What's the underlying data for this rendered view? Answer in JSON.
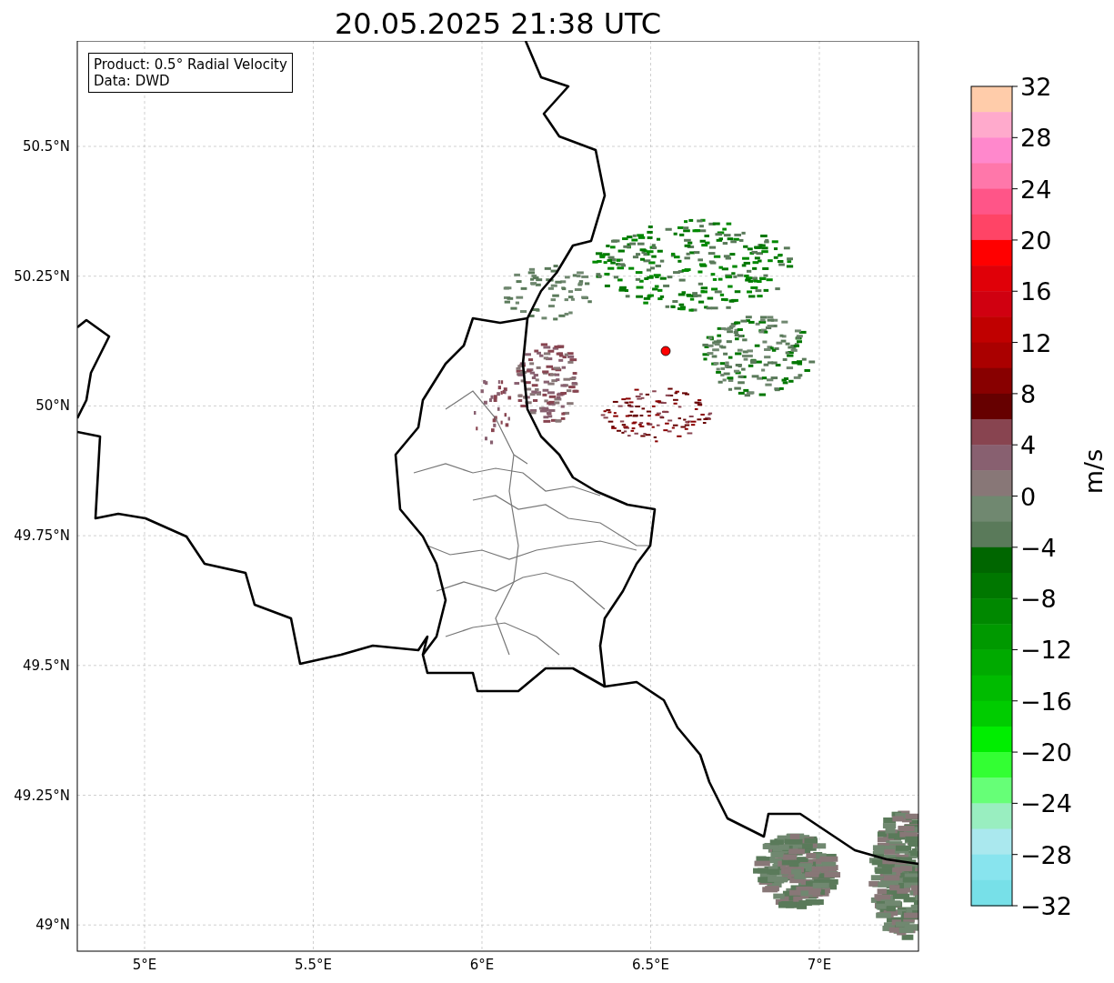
{
  "title": "20.05.2025 21:38 UTC",
  "info_box": {
    "lines": [
      "Product: 0.5° Radial Velocity",
      "Data: DWD"
    ]
  },
  "map": {
    "kind": "map",
    "lat_ticks": [
      "50.5°N",
      "50.25°N",
      "50°N",
      "49.75°N",
      "49.5°N",
      "49.25°N",
      "49°N"
    ],
    "lon_ticks": [
      "5°E",
      "5.5°E",
      "6°E",
      "6.5°E",
      "7°E"
    ]
  },
  "colorbar": {
    "label": "m/s",
    "ticks": [
      "32",
      "28",
      "24",
      "20",
      "16",
      "12",
      "8",
      "4",
      "0",
      "−4",
      "−8",
      "−12",
      "−16",
      "−20",
      "−24",
      "−28",
      "−32"
    ],
    "bins": [
      {
        "color": "#ffccaa"
      },
      {
        "color": "#ffaacc"
      },
      {
        "color": "#ff88cc"
      },
      {
        "color": "#ff77aa"
      },
      {
        "color": "#ff5588"
      },
      {
        "color": "#ff4466"
      },
      {
        "color": "#ff0000"
      },
      {
        "color": "#e00008"
      },
      {
        "color": "#d00010"
      },
      {
        "color": "#c00000"
      },
      {
        "color": "#aa0000"
      },
      {
        "color": "#880000"
      },
      {
        "color": "#660000"
      },
      {
        "color": "#884450"
      },
      {
        "color": "#886070"
      },
      {
        "color": "#887777"
      },
      {
        "color": "#708870"
      },
      {
        "color": "#5a7a5a"
      },
      {
        "color": "#006600"
      },
      {
        "color": "#007700"
      },
      {
        "color": "#008800"
      },
      {
        "color": "#009900"
      },
      {
        "color": "#00aa00"
      },
      {
        "color": "#00bb00"
      },
      {
        "color": "#00cc00"
      },
      {
        "color": "#00ee00"
      },
      {
        "color": "#33ff33"
      },
      {
        "color": "#66ff77"
      },
      {
        "color": "#99eec0"
      },
      {
        "color": "#aae8ee"
      },
      {
        "color": "#88e4ee"
      },
      {
        "color": "#77e0e8"
      }
    ]
  }
}
